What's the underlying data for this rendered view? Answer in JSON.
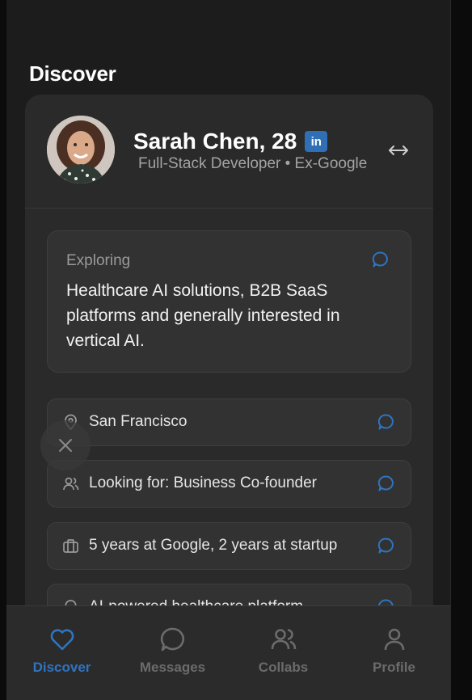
{
  "page": {
    "title": "Discover"
  },
  "profile": {
    "name": "Sarah Chen, 28",
    "linkedin_badge": "in",
    "subtitle": "Full-Stack Developer • Ex-Google",
    "exploring": {
      "label": "Exploring",
      "text": "Healthcare AI solutions, B2B SaaS platforms and generally interested in vertical AI."
    },
    "info_rows": [
      {
        "icon": "location-pin-icon",
        "text": "San Francisco"
      },
      {
        "icon": "people-icon",
        "text": "Looking for: Business Co-founder"
      },
      {
        "icon": "briefcase-icon",
        "text": "5 years at Google, 2 years at startup"
      },
      {
        "icon": "lightbulb-icon",
        "text": "AI-powered healthcare platform"
      }
    ]
  },
  "tabs": [
    {
      "label": "Discover",
      "icon": "heart-icon",
      "active": true
    },
    {
      "label": "Messages",
      "icon": "chat-bubble-icon",
      "active": false
    },
    {
      "label": "Collabs",
      "icon": "people-icon",
      "active": false
    },
    {
      "label": "Profile",
      "icon": "person-icon",
      "active": false
    }
  ],
  "colors": {
    "accent": "#2f74c0",
    "background": "#1c1c1c",
    "card": "#2a2a2a",
    "linkedin": "#2f6fb5"
  }
}
